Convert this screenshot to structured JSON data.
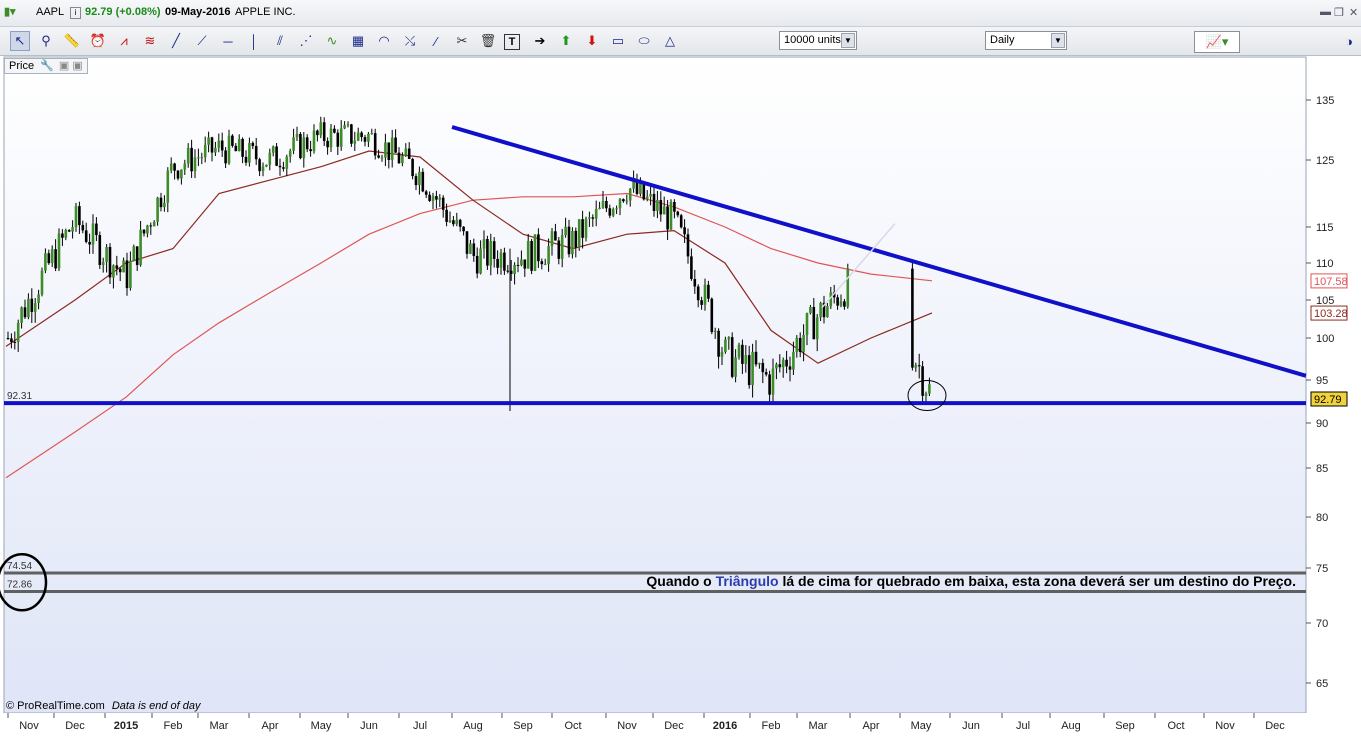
{
  "header": {
    "symbol": "AAPL",
    "price_change": "92.79 (+0.08%)",
    "date": "09-May-2016",
    "company": "APPLE INC."
  },
  "toolbar": {
    "units": "10000 units",
    "period": "Daily"
  },
  "panel": {
    "label": "Price"
  },
  "footer": {
    "credit": "© ProRealTime.com",
    "note": "Data is end of day"
  },
  "colors": {
    "background_top": "#ffffff",
    "background_bottom": "#dfe5f7",
    "candle_up": "#3c8c28",
    "candle_down": "#000000",
    "trendline": "#1010c8",
    "ma_short": "#8b2a1e",
    "ma_long": "#e05555",
    "hline": "#606060",
    "last_price_bg": "#f0d23c"
  },
  "annotation": {
    "prefix": "Quando o ",
    "highlight": "Triângulo",
    "suffix": " lá de cima for quebrado em baixa, esta zona deverá ser um destino do Preço."
  },
  "chart_data": {
    "type": "candlestick",
    "title": "AAPL",
    "ylim": [
      62,
      140
    ],
    "y_ticks": [
      65,
      70,
      75,
      80,
      85,
      90,
      95,
      100,
      105,
      110,
      115,
      125,
      135
    ],
    "x_ticks": [
      "Nov",
      "Dec",
      "2015",
      "Feb",
      "Mar",
      "Apr",
      "May",
      "Jun",
      "Jul",
      "Aug",
      "Sep",
      "Oct",
      "Nov",
      "Dec",
      "2016",
      "Feb",
      "Mar",
      "Apr",
      "May",
      "Jun",
      "Jul",
      "Aug",
      "Sep",
      "Oct",
      "Nov",
      "Dec"
    ],
    "price_path": [
      [
        "Nov",
        100
      ],
      [
        "Dec",
        116
      ],
      [
        "2015",
        108
      ],
      [
        "Feb",
        124
      ],
      [
        "Mar",
        127
      ],
      [
        "Apr",
        125
      ],
      [
        "May",
        129
      ],
      [
        "Jun",
        129
      ],
      [
        "Jul",
        123
      ],
      [
        "Aug",
        111
      ],
      [
        "Sep",
        111
      ],
      [
        "Oct",
        113
      ],
      [
        "Nov",
        121
      ],
      [
        "Dec",
        116
      ],
      [
        "2016",
        98
      ],
      [
        "Feb",
        95
      ],
      [
        "Mar",
        103
      ],
      [
        "Apr",
        110
      ],
      [
        "May",
        93
      ]
    ],
    "aug_low": 92.0,
    "ma_short": [
      [
        "Nov",
        99
      ],
      [
        "Dec",
        105
      ],
      [
        "2015",
        110
      ],
      [
        "Feb",
        112
      ],
      [
        "Mar",
        120
      ],
      [
        "Apr",
        122
      ],
      [
        "May",
        124
      ],
      [
        "Jun",
        126.5
      ],
      [
        "Jul",
        125.5
      ],
      [
        "Aug",
        119
      ],
      [
        "Sep",
        114
      ],
      [
        "Oct",
        112
      ],
      [
        "Nov",
        114
      ],
      [
        "Dec",
        114.5
      ],
      [
        "2016",
        110
      ],
      [
        "Feb",
        101
      ],
      [
        "Mar",
        97
      ],
      [
        "Apr",
        100
      ],
      [
        "May",
        103.3
      ]
    ],
    "ma_long": [
      [
        "Nov",
        84
      ],
      [
        "Dec",
        89
      ],
      [
        "2015",
        93
      ],
      [
        "Feb",
        98
      ],
      [
        "Mar",
        102
      ],
      [
        "Apr",
        106
      ],
      [
        "May",
        110
      ],
      [
        "Jun",
        114
      ],
      [
        "Jul",
        117
      ],
      [
        "Aug",
        119
      ],
      [
        "Sep",
        119.5
      ],
      [
        "Oct",
        119.5
      ],
      [
        "Nov",
        120
      ],
      [
        "Dec",
        118
      ],
      [
        "2016",
        115
      ],
      [
        "Feb",
        112
      ],
      [
        "Mar",
        110
      ],
      [
        "Apr",
        108.5
      ],
      [
        "May",
        107.6
      ]
    ],
    "trendline": {
      "from": [
        "Jul",
        130.5
      ],
      "to": [
        "Dec",
        95.5
      ]
    },
    "hlines": [
      {
        "value": 92.31,
        "label": "92.31"
      },
      {
        "value": 74.54,
        "label": "74.54"
      },
      {
        "value": 72.86,
        "label": "72.86"
      }
    ],
    "price_labels": [
      {
        "value": 107.58,
        "label": "107.58"
      },
      {
        "value": 103.28,
        "label": "103.28"
      },
      {
        "value": 92.79,
        "label": "92.79"
      }
    ],
    "last_price": 92.79
  }
}
